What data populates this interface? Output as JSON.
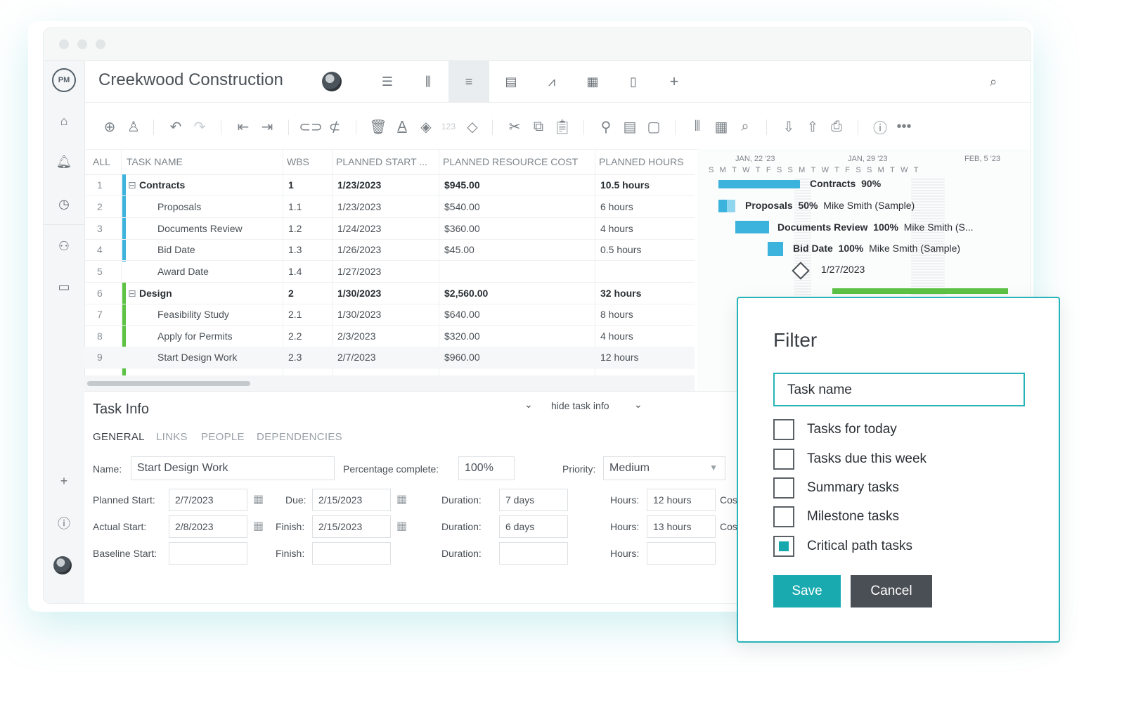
{
  "project": {
    "title": "Creekwood Construction"
  },
  "nav": [
    "home-icon",
    "notifications-icon",
    "time-icon",
    "people-icon",
    "portfolio-icon",
    "add-icon",
    "help-icon"
  ],
  "grid": {
    "headers": [
      "ALL",
      "TASK NAME",
      "WBS",
      "PLANNED START ...",
      "PLANNED RESOURCE COST",
      "PLANNED HOURS"
    ],
    "rows": [
      {
        "n": "1",
        "name": "Contracts",
        "wbs": "1",
        "start": "1/23/2023",
        "cost": "$945.00",
        "hours": "10.5 hours",
        "summary": true
      },
      {
        "n": "2",
        "name": "Proposals",
        "wbs": "1.1",
        "start": "1/23/2023",
        "cost": "$540.00",
        "hours": "6 hours"
      },
      {
        "n": "3",
        "name": "Documents Review",
        "wbs": "1.2",
        "start": "1/24/2023",
        "cost": "$360.00",
        "hours": "4 hours"
      },
      {
        "n": "4",
        "name": "Bid Date",
        "wbs": "1.3",
        "start": "1/26/2023",
        "cost": "$45.00",
        "hours": "0.5 hours"
      },
      {
        "n": "5",
        "name": "Award Date",
        "wbs": "1.4",
        "start": "1/27/2023",
        "cost": "",
        "hours": ""
      },
      {
        "n": "6",
        "name": "Design",
        "wbs": "2",
        "start": "1/30/2023",
        "cost": "$2,560.00",
        "hours": "32 hours",
        "summary": true
      },
      {
        "n": "7",
        "name": "Feasibility Study",
        "wbs": "2.1",
        "start": "1/30/2023",
        "cost": "$640.00",
        "hours": "8 hours"
      },
      {
        "n": "8",
        "name": "Apply for Permits",
        "wbs": "2.2",
        "start": "2/3/2023",
        "cost": "$320.00",
        "hours": "4 hours"
      },
      {
        "n": "9",
        "name": "Start Design Work",
        "wbs": "2.3",
        "start": "2/7/2023",
        "cost": "$960.00",
        "hours": "12 hours"
      }
    ]
  },
  "gantt": {
    "weeks": [
      "JAN, 22 '23",
      "JAN, 29 '23",
      "FEB, 5 '23"
    ],
    "days": "SMTWTFSSMTWTFSSMTWT",
    "labels": {
      "contracts": {
        "name": "Contracts",
        "pct": "90%"
      },
      "proposals": {
        "name": "Proposals",
        "pct": "50%",
        "who": "Mike Smith (Sample)"
      },
      "docs": {
        "name": "Documents Review",
        "pct": "100%",
        "who": "Mike Smith (S..."
      },
      "bid": {
        "name": "Bid Date",
        "pct": "100%",
        "who": "Mike Smith (Sample)"
      },
      "award": {
        "date": "1/27/2023"
      }
    }
  },
  "task_info": {
    "title": "Task Info",
    "toggle": "hide task info",
    "tabs": [
      "GENERAL",
      "LINKS",
      "PEOPLE",
      "DEPENDENCIES"
    ],
    "name_label": "Name:",
    "name_value": "Start Design Work",
    "pct_label": "Percentage complete:",
    "pct_value": "100%",
    "priority_label": "Priority:",
    "priority_value": "Medium",
    "planned_start_label": "Planned Start:",
    "planned_start": "2/7/2023",
    "due_label": "Due:",
    "due": "2/15/2023",
    "duration_label": "Duration:",
    "duration1": "7 days",
    "hours_label": "Hours:",
    "hours1": "12 hours",
    "cost_label": "Cos",
    "actual_start_label": "Actual Start:",
    "actual_start": "2/8/2023",
    "finish_label": "Finish:",
    "finish": "2/15/2023",
    "duration2": "6 days",
    "hours2": "13 hours",
    "baseline_label": "Baseline Start:"
  },
  "filter": {
    "title": "Filter",
    "input_value": "Task name",
    "options": [
      {
        "label": "Tasks for today",
        "checked": false
      },
      {
        "label": "Tasks due this week",
        "checked": false
      },
      {
        "label": "Summary tasks",
        "checked": false
      },
      {
        "label": "Milestone tasks",
        "checked": false
      },
      {
        "label": "Critical path tasks",
        "checked": true
      }
    ],
    "save": "Save",
    "cancel": "Cancel"
  },
  "colors": {
    "accent": "#19aab0",
    "blue_bar": "#3bb3dd",
    "green_bar": "#5cc244",
    "cancel": "#4a4f55"
  }
}
